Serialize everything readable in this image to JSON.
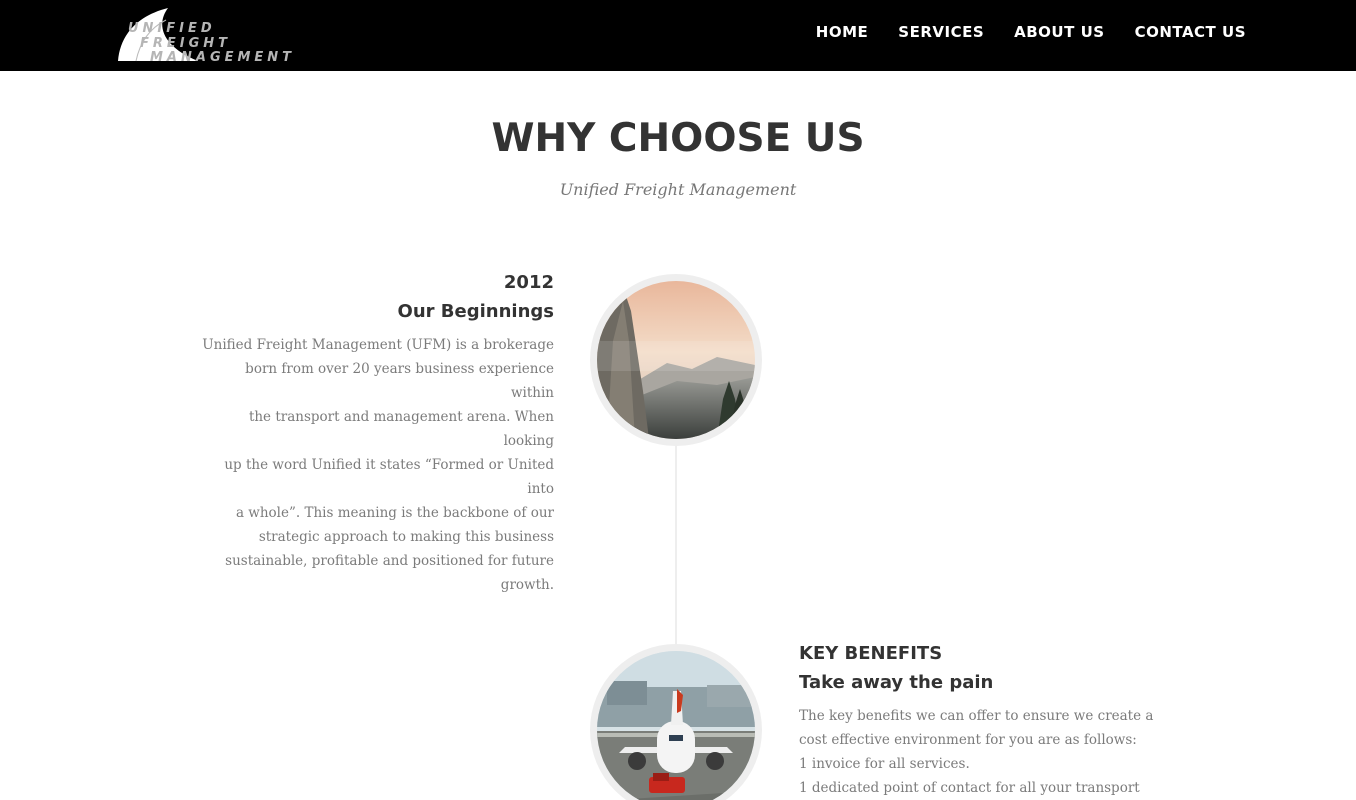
{
  "brand": {
    "logo_lines": [
      "UNIFIED",
      "FREIGHT",
      "MANAGEMENT"
    ]
  },
  "nav": {
    "items": [
      {
        "label": "HOME"
      },
      {
        "label": "SERVICES"
      },
      {
        "label": "ABOUT US"
      },
      {
        "label": "CONTACT US"
      }
    ]
  },
  "hero": {
    "title": "WHY CHOOSE US",
    "subtitle": "Unified Freight Management"
  },
  "timeline": {
    "items": [
      {
        "year": "2012",
        "heading": "Our Beginnings",
        "image": "mountain-landscape-photo",
        "lines": [
          "Unified Freight Management (UFM) is a brokerage",
          "born from over 20 years business experience within",
          "the transport and management arena. When looking",
          "up the word Unified it states “Formed or United into",
          "a whole”. This meaning is the backbone of our",
          "strategic approach to making this business",
          "sustainable, profitable and positioned for future",
          "growth."
        ]
      },
      {
        "year": "KEY BENEFITS",
        "heading": "Take away the pain",
        "image": "airplane-on-tarmac-photo",
        "lines": [
          "The key benefits we can offer to ensure we create a",
          "cost effective environment for you are as follows:",
          "1 invoice for all services.",
          "1 dedicated point of contact for all your transport"
        ]
      }
    ]
  },
  "colors": {
    "navbar_bg": "#000000",
    "heading": "#333333",
    "body_text": "#7b7b7b",
    "timeline_line": "#eeeeee"
  }
}
